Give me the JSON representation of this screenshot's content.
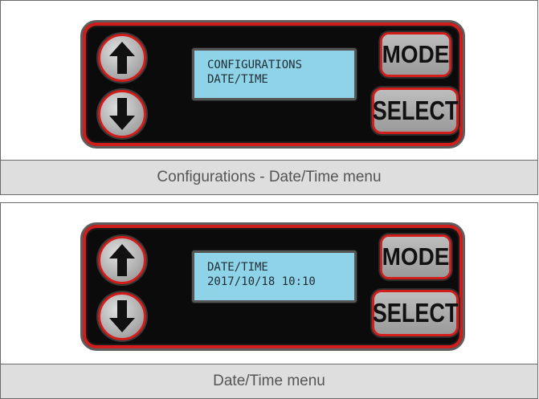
{
  "figures": [
    {
      "lcd": {
        "line1": "CONFIGURATIONS",
        "line2": "DATE/TIME"
      },
      "buttons": {
        "mode": "MODE",
        "select": "SELECT"
      },
      "caption": "Configurations - Date/Time menu"
    },
    {
      "lcd": {
        "line1": "DATE/TIME",
        "line2": "2017/10/18 10:10"
      },
      "buttons": {
        "mode": "MODE",
        "select": "SELECT"
      },
      "caption": "Date/Time menu"
    }
  ],
  "icons": {
    "up": "arrow-up-icon",
    "down": "arrow-down-icon"
  },
  "colors": {
    "lcd_background": "#8ed3e8",
    "panel_border": "#d21d1d",
    "panel": "#0b0b0b",
    "caption_bar": "#dedede"
  }
}
